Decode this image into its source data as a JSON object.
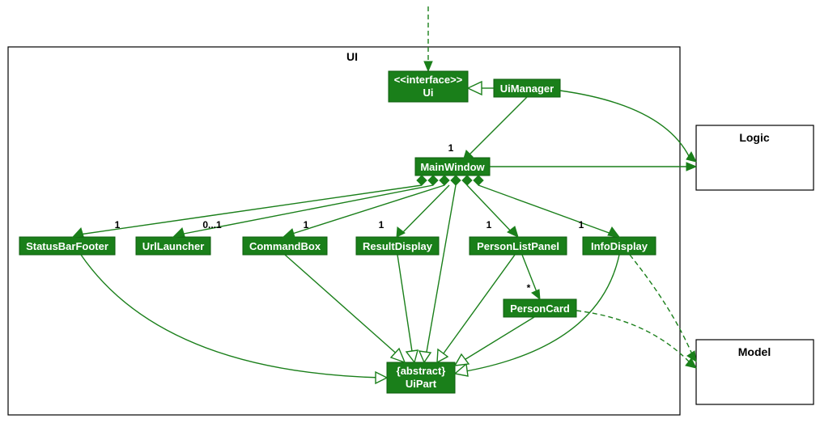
{
  "chart_data": {
    "type": "uml-class-diagram",
    "packages": [
      {
        "id": "UI",
        "label": "UI"
      },
      {
        "id": "Logic",
        "label": "Logic"
      },
      {
        "id": "Model",
        "label": "Model"
      }
    ],
    "classes": [
      {
        "id": "Ui",
        "stereotype": "<<interface>>",
        "name": "Ui",
        "package": "UI"
      },
      {
        "id": "UiManager",
        "name": "UiManager",
        "package": "UI"
      },
      {
        "id": "MainWindow",
        "name": "MainWindow",
        "package": "UI"
      },
      {
        "id": "StatusBarFooter",
        "name": "StatusBarFooter",
        "package": "UI"
      },
      {
        "id": "UrlLauncher",
        "name": "UrlLauncher",
        "package": "UI"
      },
      {
        "id": "CommandBox",
        "name": "CommandBox",
        "package": "UI"
      },
      {
        "id": "ResultDisplay",
        "name": "ResultDisplay",
        "package": "UI"
      },
      {
        "id": "PersonListPanel",
        "name": "PersonListPanel",
        "package": "UI"
      },
      {
        "id": "InfoDisplay",
        "name": "InfoDisplay",
        "package": "UI"
      },
      {
        "id": "PersonCard",
        "name": "PersonCard",
        "package": "UI"
      },
      {
        "id": "UiPart",
        "stereotype": "{abstract}",
        "name": "UiPart",
        "package": "UI"
      }
    ],
    "relationships": [
      {
        "from": "external",
        "to": "Ui",
        "type": "dependency"
      },
      {
        "from": "UiManager",
        "to": "Ui",
        "type": "realization"
      },
      {
        "from": "UiManager",
        "to": "MainWindow",
        "type": "association",
        "multiplicity_to": "1"
      },
      {
        "from": "UiManager",
        "to": "Logic",
        "type": "association"
      },
      {
        "from": "MainWindow",
        "to": "Logic",
        "type": "association"
      },
      {
        "from": "MainWindow",
        "to": "StatusBarFooter",
        "type": "composition",
        "multiplicity_to": "1"
      },
      {
        "from": "MainWindow",
        "to": "UrlLauncher",
        "type": "composition",
        "multiplicity_to": "0...1"
      },
      {
        "from": "MainWindow",
        "to": "CommandBox",
        "type": "composition",
        "multiplicity_to": "1"
      },
      {
        "from": "MainWindow",
        "to": "ResultDisplay",
        "type": "composition",
        "multiplicity_to": "1"
      },
      {
        "from": "MainWindow",
        "to": "PersonListPanel",
        "type": "composition",
        "multiplicity_to": "1"
      },
      {
        "from": "MainWindow",
        "to": "InfoDisplay",
        "type": "composition",
        "multiplicity_to": "1"
      },
      {
        "from": "PersonListPanel",
        "to": "PersonCard",
        "type": "association",
        "multiplicity_to": "*"
      },
      {
        "from": "MainWindow",
        "to": "UiPart",
        "type": "generalization"
      },
      {
        "from": "StatusBarFooter",
        "to": "UiPart",
        "type": "generalization"
      },
      {
        "from": "CommandBox",
        "to": "UiPart",
        "type": "generalization"
      },
      {
        "from": "ResultDisplay",
        "to": "UiPart",
        "type": "generalization"
      },
      {
        "from": "PersonListPanel",
        "to": "UiPart",
        "type": "generalization"
      },
      {
        "from": "InfoDisplay",
        "to": "UiPart",
        "type": "generalization"
      },
      {
        "from": "PersonCard",
        "to": "UiPart",
        "type": "generalization"
      },
      {
        "from": "PersonCard",
        "to": "Model",
        "type": "dependency"
      },
      {
        "from": "InfoDisplay",
        "to": "Model",
        "type": "dependency"
      }
    ]
  },
  "labels": {
    "pkg_ui": "UI",
    "pkg_logic": "Logic",
    "pkg_model": "Model",
    "ui_stereo": "<<interface>>",
    "ui_name": "Ui",
    "uimanager": "UiManager",
    "mainwindow": "MainWindow",
    "statusbarfooter": "StatusBarFooter",
    "urllauncher": "UrlLauncher",
    "commandbox": "CommandBox",
    "resultdisplay": "ResultDisplay",
    "personlistpanel": "PersonListPanel",
    "infodisplay": "InfoDisplay",
    "personcard": "PersonCard",
    "uipart_stereo": "{abstract}",
    "uipart_name": "UiPart",
    "m1": "1",
    "m0_1": "0...1",
    "mStar": "*"
  }
}
